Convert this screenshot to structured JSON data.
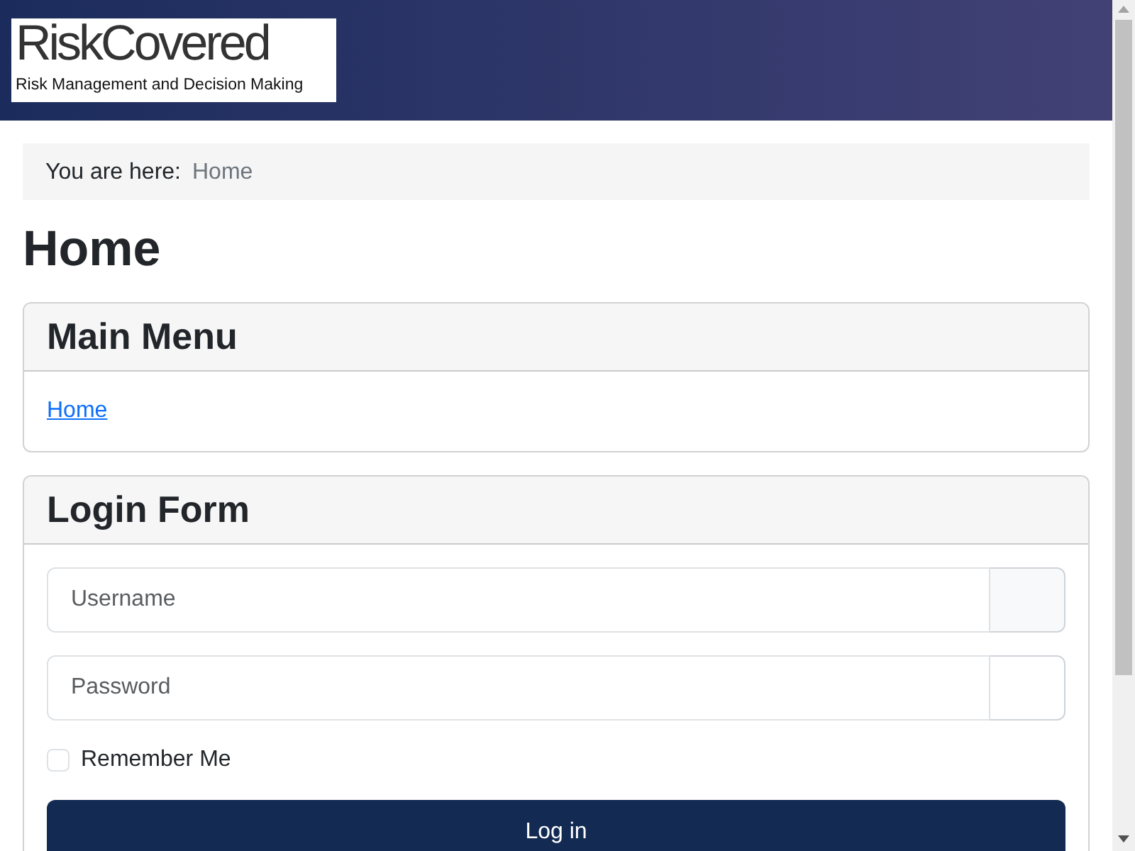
{
  "header": {
    "logo_title": "RiskCovered",
    "logo_tagline": "Risk Management and Decision Making"
  },
  "breadcrumb": {
    "label": "You are here:",
    "items": [
      "Home"
    ]
  },
  "page_title": "Home",
  "main_menu": {
    "title": "Main Menu",
    "links": [
      "Home"
    ]
  },
  "login_form": {
    "title": "Login Form",
    "fields": [
      {
        "placeholder": "Username"
      },
      {
        "placeholder": "Password"
      }
    ],
    "remember": {
      "label": "Remember Me",
      "checked": false
    },
    "submit": "Log in"
  }
}
